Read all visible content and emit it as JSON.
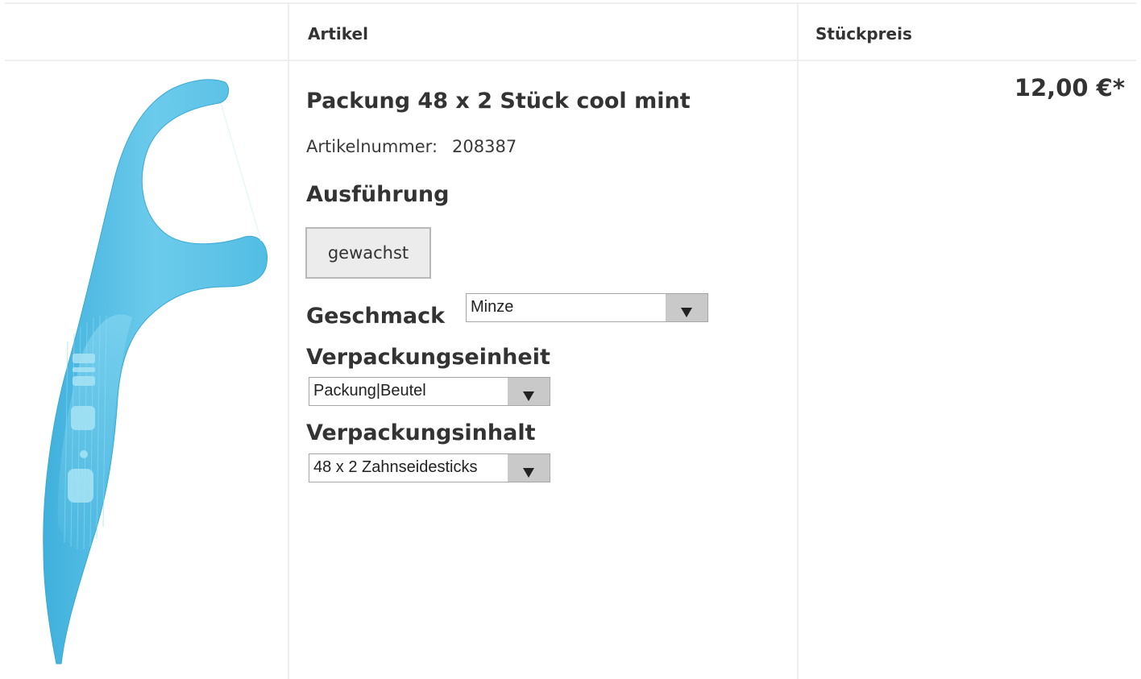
{
  "table_header": {
    "col_image": "",
    "col_article": "Artikel",
    "col_price": "Stückpreis"
  },
  "product": {
    "image_icon": "dental-floss-pick-image",
    "image_alt": "GUM",
    "title": "Packung 48 x 2 Stück cool mint",
    "article_number_label": "Artikelnummer:",
    "article_number": "208387",
    "price": "12,00 €*"
  },
  "options": {
    "ausfuehrung": {
      "label": "Ausführung",
      "button_label": "gewachst"
    },
    "geschmack": {
      "label": "Geschmack",
      "selected": "Minze"
    },
    "verpackungseinheit": {
      "label": "Verpackungseinheit",
      "selected": "Packung|Beutel"
    },
    "verpackungsinhalt": {
      "label": "Verpackungsinhalt",
      "selected": "48 x 2 Zahnseidesticks"
    }
  },
  "colors": {
    "product_blue": "#5ec3e6",
    "divider": "#eeeeee",
    "select_arrow_bg": "#c9c9c9"
  }
}
